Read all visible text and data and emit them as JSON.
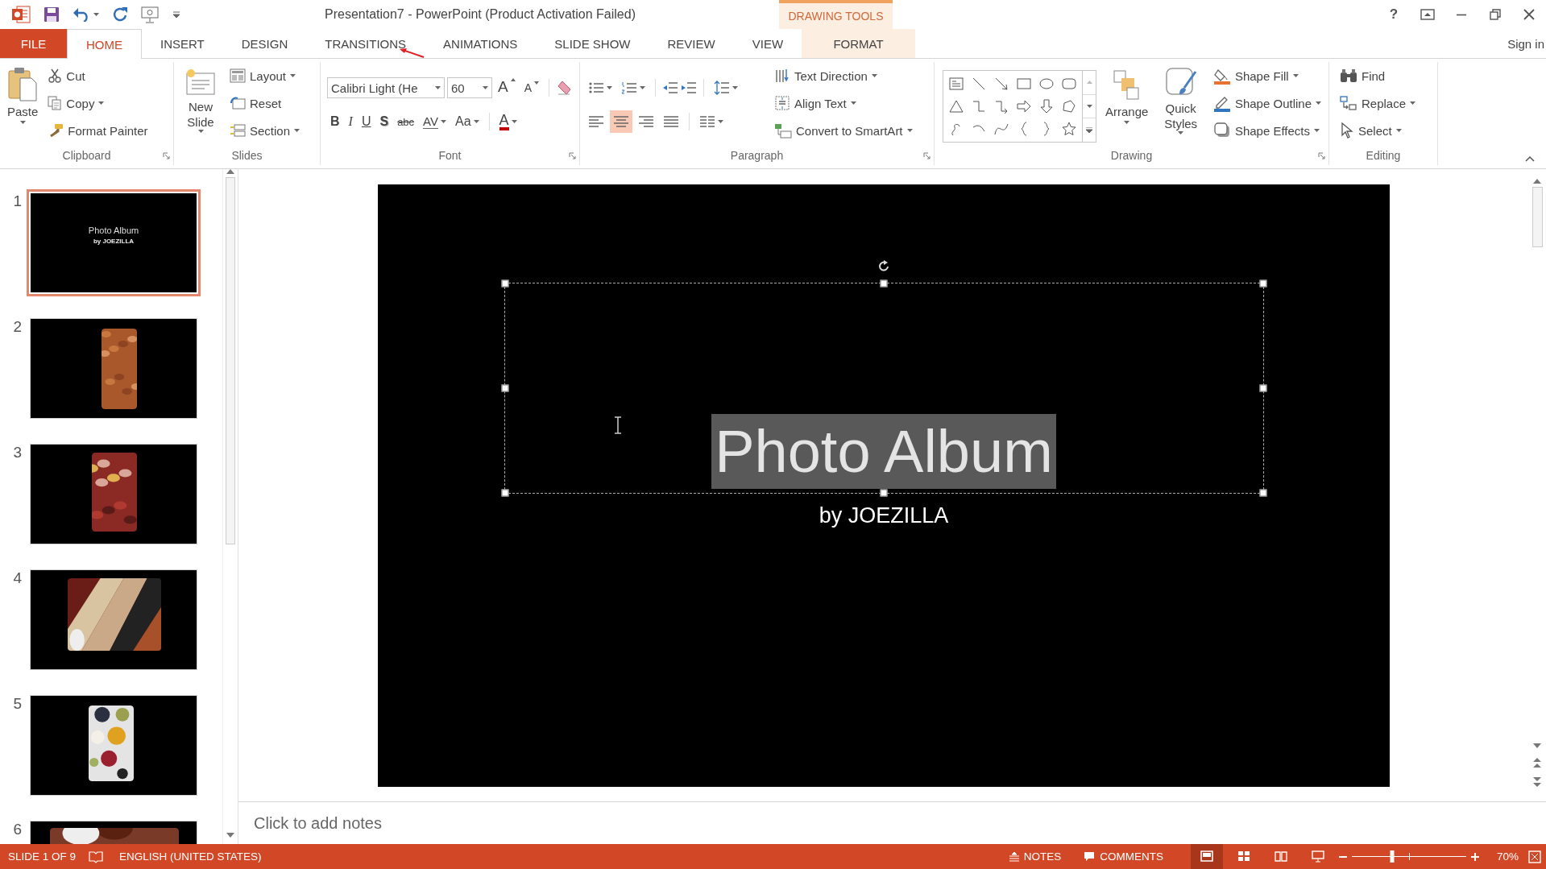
{
  "window": {
    "title": "Presentation7 - PowerPoint (Product Activation Failed)",
    "help": "?"
  },
  "contextual_tab_group": {
    "label": "DRAWING TOOLS"
  },
  "tabs": [
    {
      "label": "FILE",
      "kind": "file",
      "selected": false
    },
    {
      "label": "HOME",
      "kind": "normal",
      "selected": true
    },
    {
      "label": "INSERT",
      "kind": "normal",
      "selected": false
    },
    {
      "label": "DESIGN",
      "kind": "normal",
      "selected": false
    },
    {
      "label": "TRANSITIONS",
      "kind": "normal",
      "selected": false
    },
    {
      "label": "ANIMATIONS",
      "kind": "normal",
      "selected": false
    },
    {
      "label": "SLIDE SHOW",
      "kind": "normal",
      "selected": false
    },
    {
      "label": "REVIEW",
      "kind": "normal",
      "selected": false
    },
    {
      "label": "VIEW",
      "kind": "normal",
      "selected": false
    },
    {
      "label": "FORMAT",
      "kind": "contextual",
      "selected": false
    }
  ],
  "account": {
    "label": "Sign in"
  },
  "ribbon": {
    "clipboard": {
      "label": "Clipboard",
      "paste": {
        "label": "Paste",
        "menu": true
      },
      "items": [
        {
          "label": "Cut",
          "menu": false
        },
        {
          "label": "Copy",
          "menu": true
        },
        {
          "label": "Format Painter",
          "menu": false
        }
      ]
    },
    "slides": {
      "label": "Slides",
      "new_slide": {
        "label": "New Slide",
        "menu": true
      },
      "items": [
        {
          "label": "Layout",
          "menu": true
        },
        {
          "label": "Reset",
          "menu": false
        },
        {
          "label": "Section",
          "menu": true
        }
      ]
    },
    "font": {
      "label": "Font",
      "font_name": "Calibri Light (He",
      "font_size": "60",
      "grow": "A",
      "shrink": "A",
      "format_buttons": [
        {
          "label": "B",
          "kind": "bold",
          "menu": false
        },
        {
          "label": "I",
          "kind": "italic",
          "menu": false
        },
        {
          "label": "U",
          "kind": "underline",
          "menu": false
        },
        {
          "label": "S",
          "kind": "shadow",
          "menu": false
        },
        {
          "label": "abc",
          "kind": "strike",
          "menu": false
        },
        {
          "label": "AV",
          "kind": "spacing",
          "menu": true
        },
        {
          "label": "Aa",
          "kind": "case",
          "menu": true
        }
      ],
      "color_button": {
        "label": "A",
        "menu": true
      }
    },
    "paragraph": {
      "label": "Paragraph",
      "alignment": [
        {
          "kind": "left",
          "selected": false
        },
        {
          "kind": "center",
          "selected": true
        },
        {
          "kind": "right",
          "selected": false
        },
        {
          "kind": "justify",
          "selected": false
        }
      ],
      "items": [
        {
          "label": "Text Direction",
          "menu": true
        },
        {
          "label": "Align Text",
          "menu": true
        },
        {
          "label": "Convert to SmartArt",
          "menu": true
        }
      ]
    },
    "drawing": {
      "label": "Drawing",
      "arrange": {
        "label": "Arrange",
        "menu": true
      },
      "quick_styles": {
        "label": "Quick Styles",
        "menu": true
      },
      "items": [
        {
          "label": "Shape Fill",
          "menu": true
        },
        {
          "label": "Shape Outline",
          "menu": true
        },
        {
          "label": "Shape Effects",
          "menu": true
        }
      ]
    },
    "editing": {
      "label": "Editing",
      "items": [
        {
          "label": "Find",
          "menu": false
        },
        {
          "label": "Replace",
          "menu": true
        },
        {
          "label": "Select",
          "menu": true
        }
      ]
    }
  },
  "thumbnails": [
    {
      "number": "1",
      "kind": "title",
      "selected": true,
      "title": "Photo Album",
      "subtitle": "by JOEZILLA"
    },
    {
      "number": "2",
      "kind": "picture",
      "selected": false
    },
    {
      "number": "3",
      "kind": "picture",
      "selected": false
    },
    {
      "number": "4",
      "kind": "picture",
      "selected": false
    },
    {
      "number": "5",
      "kind": "picture",
      "selected": false
    },
    {
      "number": "6",
      "kind": "picture",
      "selected": false
    }
  ],
  "slide": {
    "title": "Photo Album",
    "subtitle": "by JOEZILLA",
    "title_selected": true
  },
  "notes": {
    "placeholder": "Click to add notes"
  },
  "status_bar": {
    "slide": "SLIDE 1 OF 9",
    "language": "ENGLISH (UNITED STATES)",
    "notes": "NOTES",
    "comments": "COMMENTS",
    "views": [
      {
        "kind": "normal",
        "selected": true
      },
      {
        "kind": "sorter",
        "selected": false
      },
      {
        "kind": "reading",
        "selected": false
      },
      {
        "kind": "slideshow",
        "selected": false
      }
    ],
    "zoom": {
      "level": 0.35,
      "reading": "70%"
    }
  }
}
